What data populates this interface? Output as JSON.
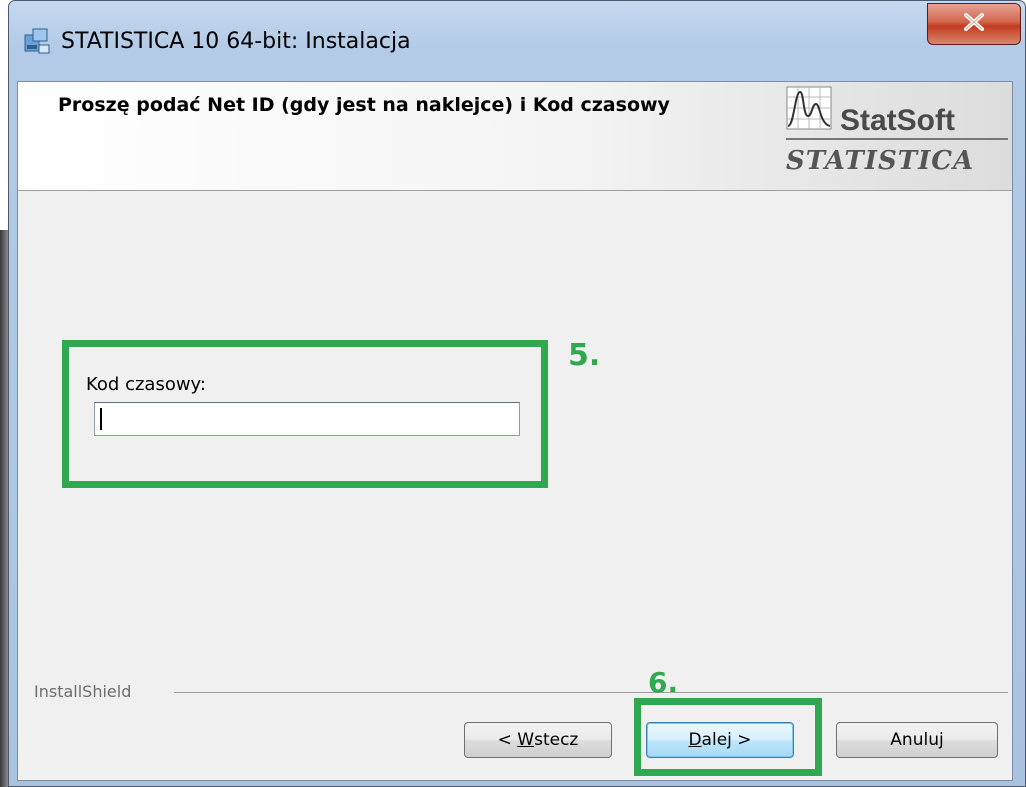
{
  "window": {
    "title": "STATISTICA 10 64-bit: Instalacja"
  },
  "header": {
    "title": "Proszę podać Net ID (gdy jest na naklejce) i Kod czasowy",
    "logo_brand": "StatSoft",
    "logo_product": "STATISTICA"
  },
  "form": {
    "time_code_label": "Kod czasowy:",
    "time_code_value": ""
  },
  "annotations": {
    "step5": "5.",
    "step6": "6.",
    "highlight_color": "#2fa84f"
  },
  "footer": {
    "installshield": "InstallShield"
  },
  "buttons": {
    "back_prefix": "< ",
    "back_mnemonic": "W",
    "back_rest": "stecz",
    "next_mnemonic": "D",
    "next_rest": "alej >",
    "cancel": "Anuluj"
  },
  "icons": {
    "close": "close-icon",
    "app": "installer-icon",
    "logo": "statsoft-logo-graph"
  }
}
